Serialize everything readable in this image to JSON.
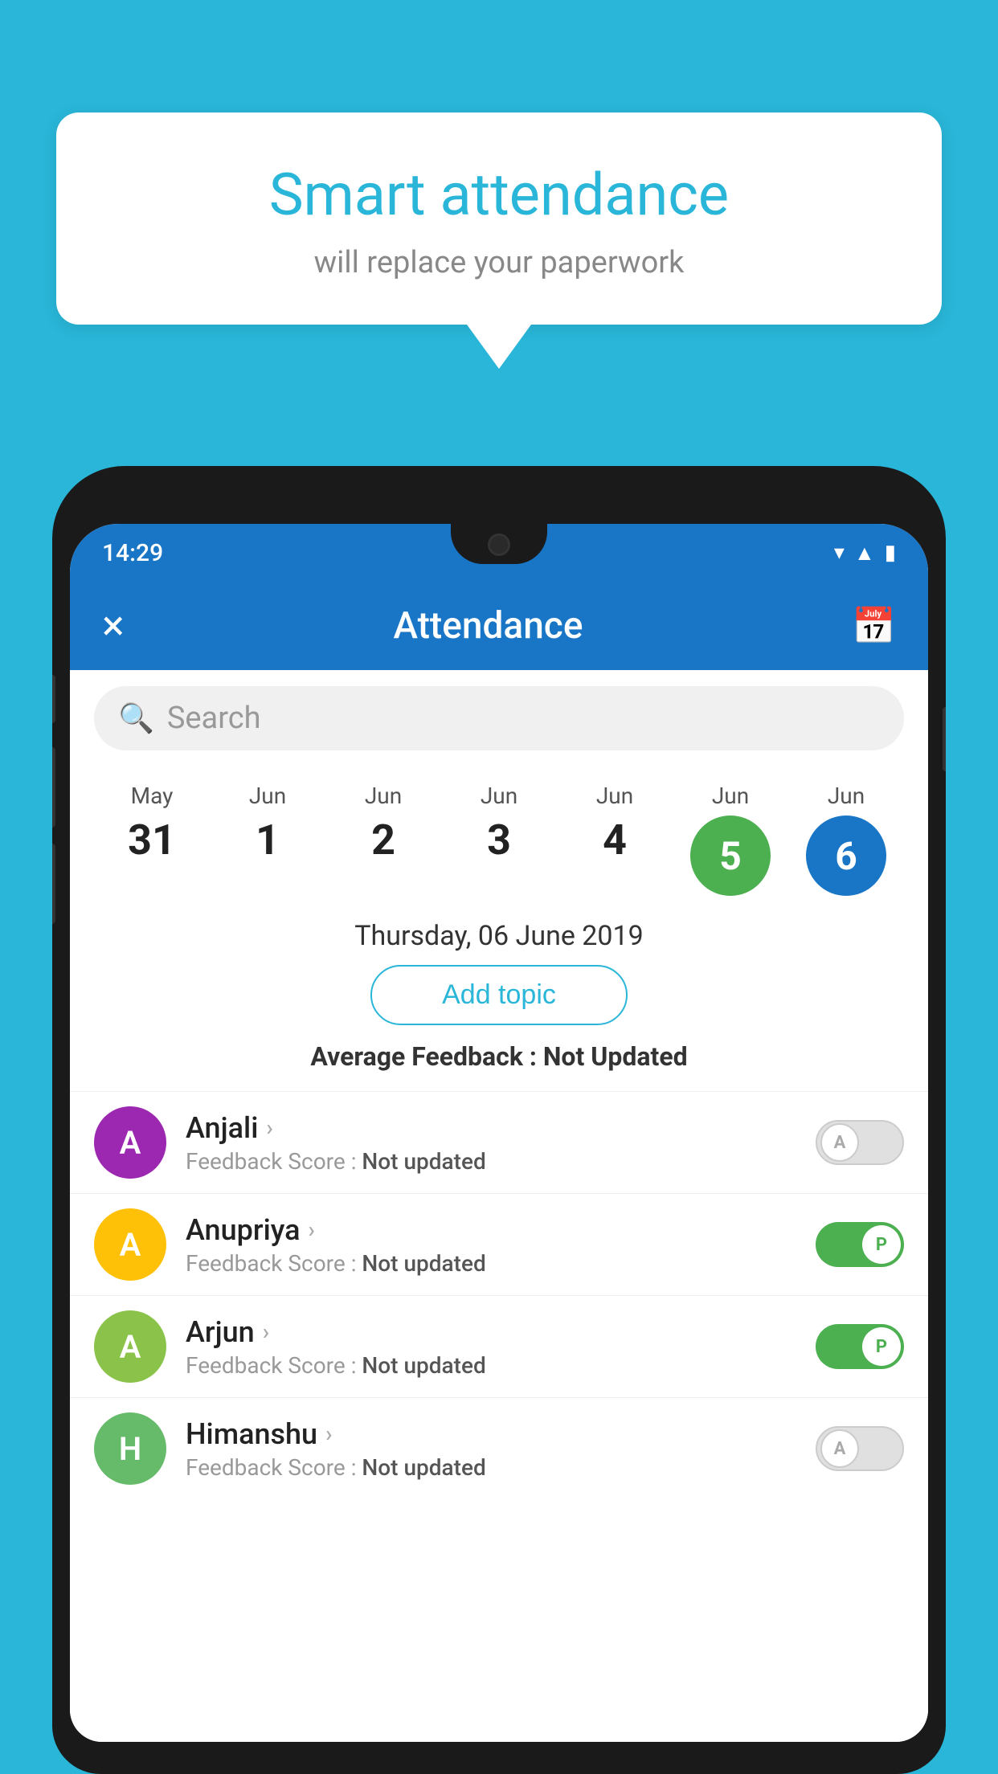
{
  "background_color": "#29b6d8",
  "speech_bubble": {
    "title": "Smart attendance",
    "subtitle": "will replace your paperwork"
  },
  "status_bar": {
    "time": "14:29",
    "icons": [
      "wifi",
      "signal",
      "battery"
    ]
  },
  "app_bar": {
    "close_label": "×",
    "title": "Attendance",
    "calendar_icon": "calendar"
  },
  "search": {
    "placeholder": "Search"
  },
  "dates": [
    {
      "month": "May",
      "day": "31",
      "highlight": null
    },
    {
      "month": "Jun",
      "day": "1",
      "highlight": null
    },
    {
      "month": "Jun",
      "day": "2",
      "highlight": null
    },
    {
      "month": "Jun",
      "day": "3",
      "highlight": null
    },
    {
      "month": "Jun",
      "day": "4",
      "highlight": null
    },
    {
      "month": "Jun",
      "day": "5",
      "highlight": "green"
    },
    {
      "month": "Jun",
      "day": "6",
      "highlight": "blue"
    }
  ],
  "selected_date": "Thursday, 06 June 2019",
  "add_topic_label": "Add topic",
  "avg_feedback_label": "Average Feedback :",
  "avg_feedback_value": "Not Updated",
  "students": [
    {
      "name": "Anjali",
      "avatar_letter": "A",
      "avatar_color": "purple",
      "feedback_label": "Feedback Score :",
      "feedback_value": "Not updated",
      "attendance": "A",
      "toggle_on": false
    },
    {
      "name": "Anupriya",
      "avatar_letter": "A",
      "avatar_color": "yellow",
      "feedback_label": "Feedback Score :",
      "feedback_value": "Not updated",
      "attendance": "P",
      "toggle_on": true
    },
    {
      "name": "Arjun",
      "avatar_letter": "A",
      "avatar_color": "green",
      "feedback_label": "Feedback Score :",
      "feedback_value": "Not updated",
      "attendance": "P",
      "toggle_on": true
    },
    {
      "name": "Himanshu",
      "avatar_letter": "H",
      "avatar_color": "green2",
      "feedback_label": "Feedback Score :",
      "feedback_value": "Not updated",
      "attendance": "A",
      "toggle_on": false
    }
  ]
}
